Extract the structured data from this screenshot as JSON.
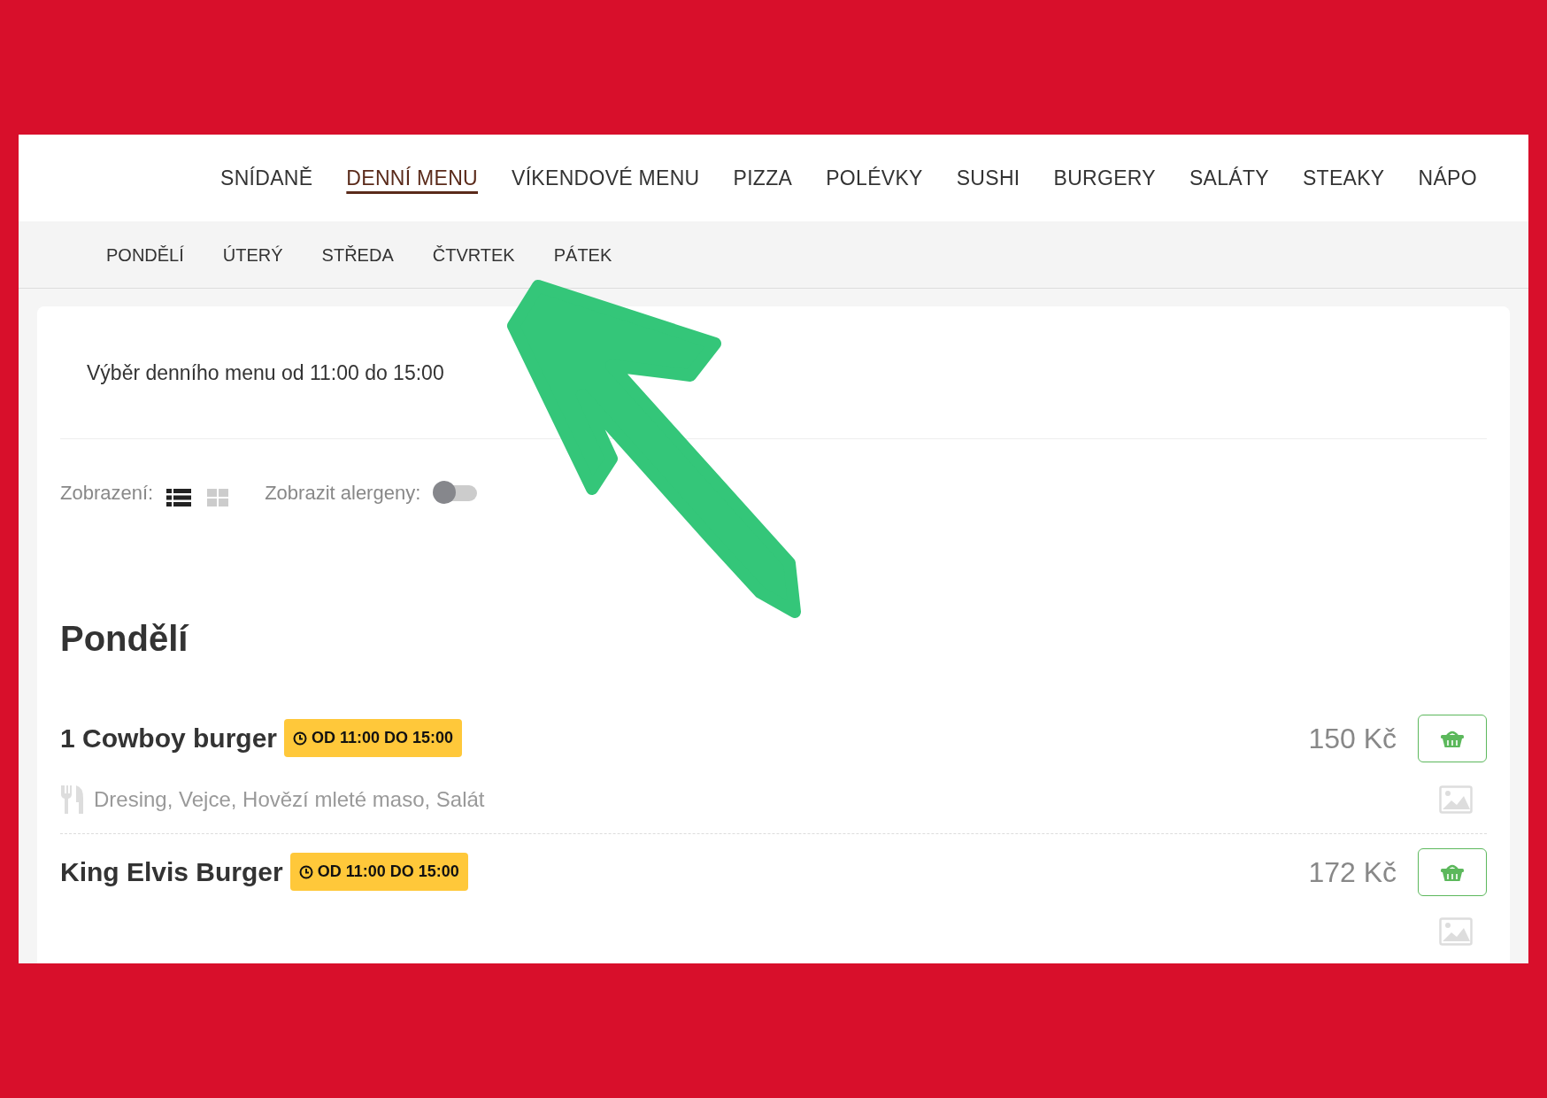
{
  "top_nav": [
    {
      "label": "SNÍDANĚ",
      "selected": false
    },
    {
      "label": "DENNÍ MENU",
      "selected": true
    },
    {
      "label": "VÍKENDOVÉ MENU",
      "selected": false
    },
    {
      "label": "PIZZA",
      "selected": false
    },
    {
      "label": "POLÉVKY",
      "selected": false
    },
    {
      "label": "SUSHI",
      "selected": false
    },
    {
      "label": "BURGERY",
      "selected": false
    },
    {
      "label": "SALÁTY",
      "selected": false
    },
    {
      "label": "STEAKY",
      "selected": false
    },
    {
      "label": "NÁPO",
      "selected": false
    }
  ],
  "day_tabs": [
    {
      "label": "PONDĚLÍ",
      "selected": false
    },
    {
      "label": "ÚTERÝ",
      "selected": false
    },
    {
      "label": "STŘEDA",
      "selected": false
    },
    {
      "label": "ČTVRTEK",
      "selected": false
    },
    {
      "label": "PÁTEK",
      "selected": false
    }
  ],
  "intro": "Výběr denního menu od 11:00 do 15:00",
  "view_label": "Zobrazení:",
  "view_modes": [
    {
      "kind": "list",
      "selected": true
    },
    {
      "kind": "grid",
      "selected": false
    }
  ],
  "allergen_label": "Zobrazit alergeny:",
  "allergen_toggle": {
    "on": false
  },
  "day_heading": "Pondělí",
  "items": [
    {
      "name": "1 Cowboy burger",
      "time_badge": "OD 11:00 DO 15:00",
      "price": "150 Kč",
      "ingredients": "Dresing, Vejce, Hovězí mleté maso, Salát"
    },
    {
      "name": "King Elvis Burger",
      "time_badge": "OD 11:00 DO 15:00",
      "price": "172 Kč"
    }
  ]
}
